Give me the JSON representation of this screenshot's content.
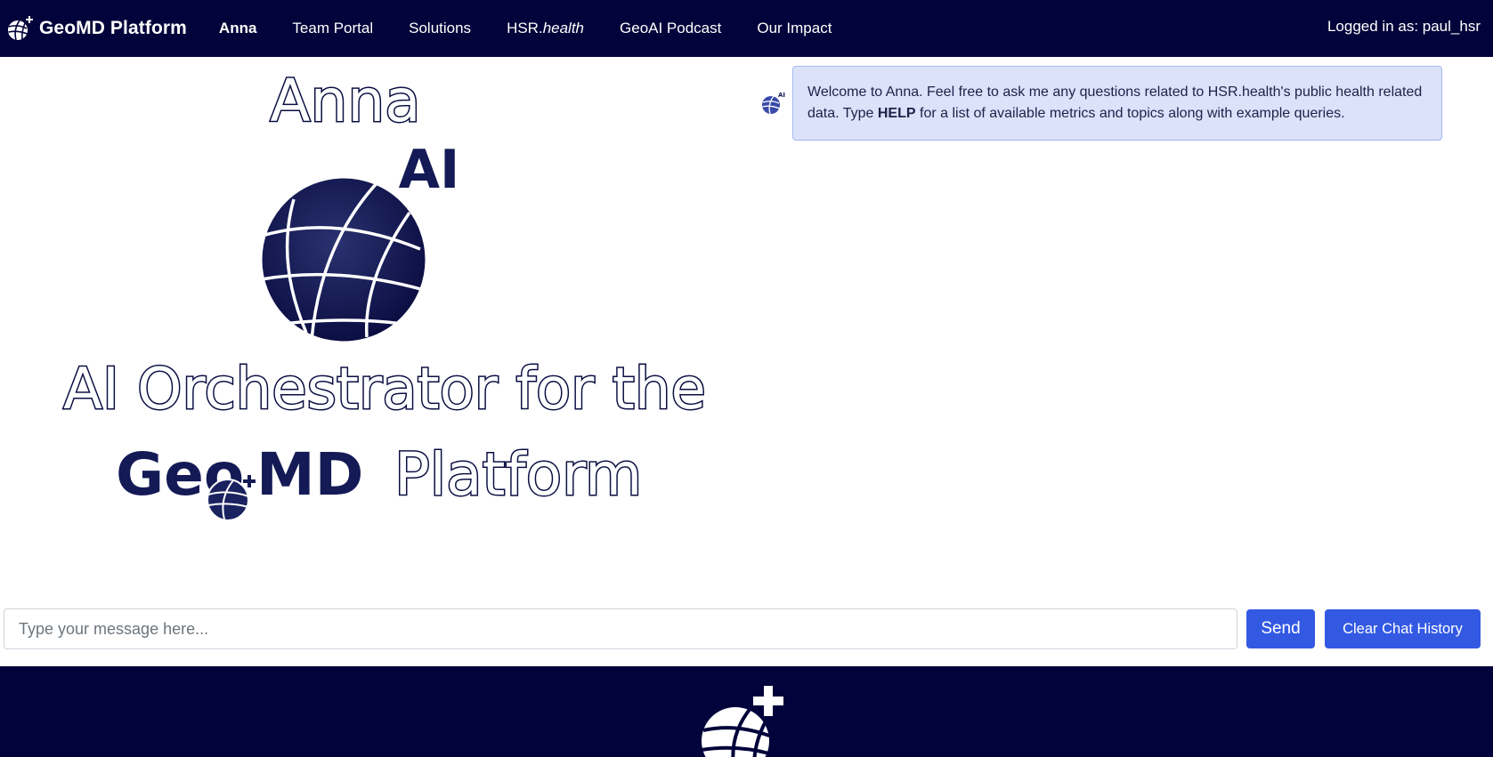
{
  "navbar": {
    "brand": "GeoMD Platform",
    "links": [
      {
        "label": "Anna"
      },
      {
        "label": "Team Portal"
      },
      {
        "label": "Solutions"
      },
      {
        "label_prefix": "HSR.",
        "label_italic": "health"
      },
      {
        "label": "GeoAI Podcast"
      },
      {
        "label": "Our Impact"
      }
    ],
    "login_status": "Logged in as: paul_hsr"
  },
  "hero": {
    "title": "Anna",
    "ai_badge": "AI",
    "tagline": "AI Orchestrator for the",
    "brand_geo": "Geo",
    "brand_md": "MD",
    "brand_platform": "Platform"
  },
  "chat": {
    "messages": [
      {
        "text_before": "Welcome to Anna. Feel free to ask me any questions related to HSR.health's public health related data. Type ",
        "text_bold": "HELP",
        "text_after": " for a list of available metrics and topics along with example queries."
      }
    ]
  },
  "input": {
    "placeholder": "Type your message here...",
    "value": "",
    "send_label": "Send",
    "clear_label": "Clear Chat History"
  },
  "colors": {
    "navy": "#02033a",
    "accent": "#3359e3",
    "bubble_bg": "#dbe2fa"
  }
}
